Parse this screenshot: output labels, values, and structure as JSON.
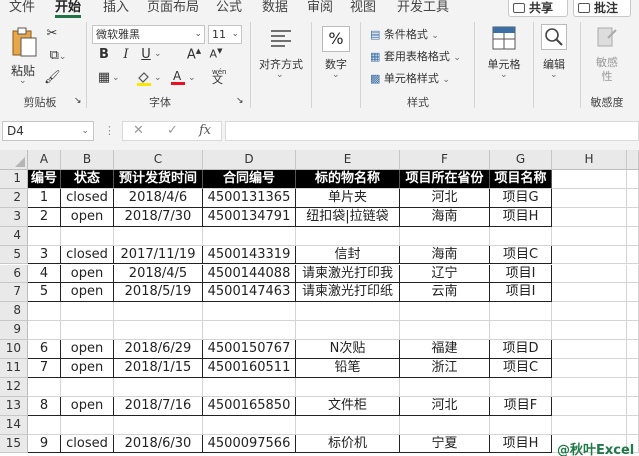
{
  "tabs": [
    "文件",
    "开始",
    "插入",
    "页面布局",
    "公式",
    "数据",
    "审阅",
    "视图",
    "开发工具"
  ],
  "active_tab": "开始",
  "share_label": "共享",
  "comment_label": "批注",
  "ribbon": {
    "clipboard": {
      "label": "剪贴板",
      "paste_label": "粘贴"
    },
    "font": {
      "label": "字体",
      "font_name": "微软雅黑",
      "font_size": "11",
      "bold": "B",
      "italic": "I",
      "underline": "U",
      "grow": "A",
      "shrink": "A",
      "wen": "wén"
    },
    "alignment": {
      "label": "对齐方式"
    },
    "number": {
      "label": "数字",
      "symbol": "%"
    },
    "styles": {
      "label": "样式",
      "conditional": "条件格式",
      "table_format": "套用表格格式",
      "cell_style": "单元格样式"
    },
    "cells": {
      "label": "单元格"
    },
    "editing": {
      "label": "编辑"
    },
    "sensitivity": {
      "label": "敏感度",
      "button": "敏感性"
    }
  },
  "name_box": "D4",
  "formula_bar": {
    "fx": "fx",
    "cancel": "✕",
    "confirm": "✓",
    "value": ""
  },
  "columns": [
    "A",
    "B",
    "C",
    "D",
    "E",
    "F",
    "G",
    "H"
  ],
  "rows": [
    [
      "编号",
      "状态",
      "预计发货时间",
      "合同编号",
      "标的物名称",
      "项目所在省份",
      "项目名称"
    ],
    [
      "1",
      "closed",
      "2018/4/6",
      "4500131365",
      "单片夹",
      "河北",
      "项目G"
    ],
    [
      "2",
      "open",
      "2018/7/30",
      "4500134791",
      "纽扣袋|拉链袋",
      "海南",
      "项目H"
    ],
    [
      "",
      "",
      "",
      "",
      "",
      "",
      ""
    ],
    [
      "3",
      "closed",
      "2017/11/19",
      "4500143319",
      "信封",
      "海南",
      "项目C"
    ],
    [
      "4",
      "open",
      "2018/4/5",
      "4500144088",
      "请柬激光打印我",
      "辽宁",
      "项目I"
    ],
    [
      "5",
      "open",
      "2018/5/19",
      "4500147463",
      "请柬激光打印纸",
      "云南",
      "项目I"
    ],
    [
      "",
      "",
      "",
      "",
      "",
      "",
      ""
    ],
    [
      "",
      "",
      "",
      "",
      "",
      "",
      ""
    ],
    [
      "6",
      "open",
      "2018/6/29",
      "4500150767",
      "N次贴",
      "福建",
      "项目D"
    ],
    [
      "7",
      "open",
      "2018/1/15",
      "4500160511",
      "铅笔",
      "浙江",
      "项目C"
    ],
    [
      "",
      "",
      "",
      "",
      "",
      "",
      ""
    ],
    [
      "8",
      "open",
      "2018/7/16",
      "4500165850",
      "文件柜",
      "河北",
      "项目F"
    ],
    [
      "",
      "",
      "",
      "",
      "",
      "",
      ""
    ],
    [
      "9",
      "closed",
      "2018/6/30",
      "4500097566",
      "标价机",
      "宁夏",
      "项目H"
    ]
  ],
  "row_numbers": [
    "1",
    "2",
    "3",
    "4",
    "5",
    "6",
    "7",
    "8",
    "9",
    "10",
    "11",
    "12",
    "13",
    "14",
    "15"
  ],
  "watermark": "@秋叶Excel"
}
